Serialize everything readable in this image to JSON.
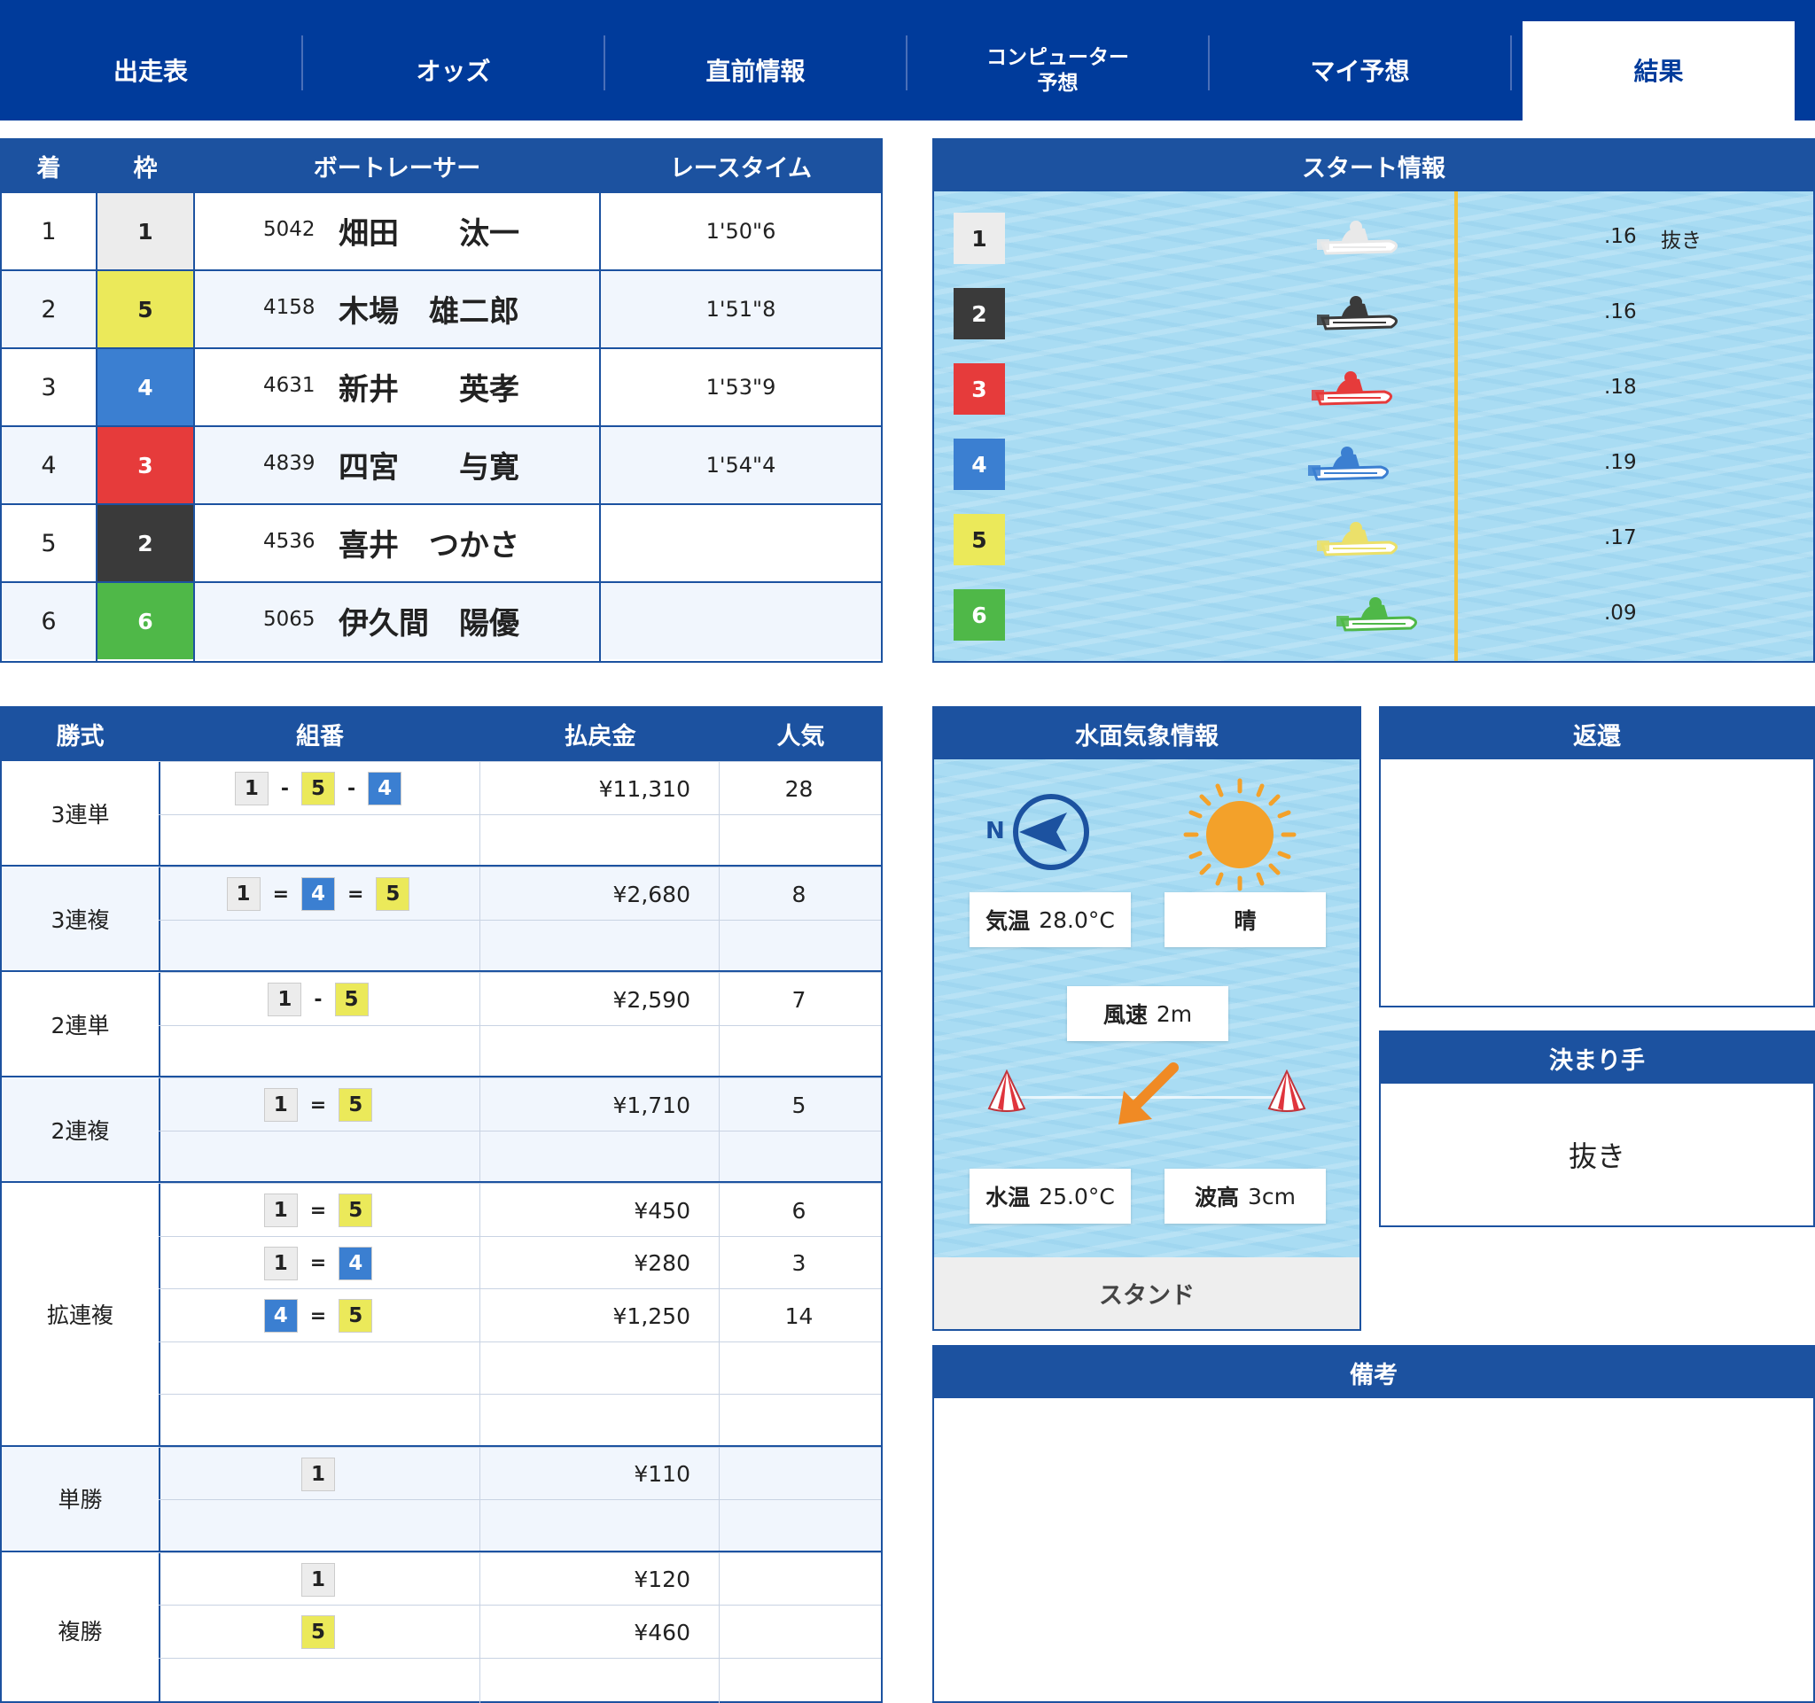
{
  "tabs": [
    {
      "label": "出走表"
    },
    {
      "label": "オッズ"
    },
    {
      "label": "直前情報"
    },
    {
      "label": "コンピューター",
      "label2": "予想"
    },
    {
      "label": "マイ予想"
    },
    {
      "label": "結果"
    }
  ],
  "results": {
    "headers": {
      "rank": "着",
      "lane": "枠",
      "racer": "ボートレーサー",
      "time": "レースタイム"
    },
    "rows": [
      {
        "rank": "1",
        "lane": "1",
        "reg_no": "5042",
        "name": "畑田　　汰一",
        "time": "1'50\"6"
      },
      {
        "rank": "2",
        "lane": "5",
        "reg_no": "4158",
        "name": "木場　雄二郎",
        "time": "1'51\"8"
      },
      {
        "rank": "3",
        "lane": "4",
        "reg_no": "4631",
        "name": "新井　　英孝",
        "time": "1'53\"9"
      },
      {
        "rank": "4",
        "lane": "3",
        "reg_no": "4839",
        "name": "四宮　　与寛",
        "time": "1'54\"4"
      },
      {
        "rank": "5",
        "lane": "2",
        "reg_no": "4536",
        "name": "喜井　つかさ",
        "time": ""
      },
      {
        "rank": "6",
        "lane": "6",
        "reg_no": "5065",
        "name": "伊久間　陽優",
        "time": ""
      }
    ]
  },
  "start_info": {
    "title": "スタート情報",
    "rows": [
      {
        "lane": "1",
        "st": ".16",
        "tech": "抜き"
      },
      {
        "lane": "2",
        "st": ".16",
        "tech": ""
      },
      {
        "lane": "3",
        "st": ".18",
        "tech": ""
      },
      {
        "lane": "4",
        "st": ".19",
        "tech": ""
      },
      {
        "lane": "5",
        "st": ".17",
        "tech": ""
      },
      {
        "lane": "6",
        "st": ".09",
        "tech": ""
      }
    ]
  },
  "payouts": {
    "headers": {
      "type": "勝式",
      "combo": "組番",
      "amount": "払戻金",
      "popularity": "人気"
    },
    "sections": [
      {
        "type": "3連単",
        "lines": [
          {
            "c": [
              "1",
              "5",
              "4"
            ],
            "s": "-",
            "amount": "¥11,310",
            "pop": "28"
          },
          {}
        ]
      },
      {
        "type": "3連複",
        "lines": [
          {
            "c": [
              "1",
              "4",
              "5"
            ],
            "s": "=",
            "amount": "¥2,680",
            "pop": "8"
          },
          {}
        ]
      },
      {
        "type": "2連単",
        "lines": [
          {
            "c": [
              "1",
              "5"
            ],
            "s": "-",
            "amount": "¥2,590",
            "pop": "7"
          },
          {}
        ]
      },
      {
        "type": "2連複",
        "lines": [
          {
            "c": [
              "1",
              "5"
            ],
            "s": "=",
            "amount": "¥1,710",
            "pop": "5"
          },
          {}
        ]
      },
      {
        "type": "拡連複",
        "lines": [
          {
            "c": [
              "1",
              "5"
            ],
            "s": "=",
            "amount": "¥450",
            "pop": "6"
          },
          {
            "c": [
              "1",
              "4"
            ],
            "s": "=",
            "amount": "¥280",
            "pop": "3"
          },
          {
            "c": [
              "4",
              "5"
            ],
            "s": "=",
            "amount": "¥1,250",
            "pop": "14"
          },
          {},
          {}
        ]
      },
      {
        "type": "単勝",
        "lines": [
          {
            "c": [
              "1"
            ],
            "s": "",
            "amount": "¥110",
            "pop": ""
          },
          {}
        ]
      },
      {
        "type": "複勝",
        "lines": [
          {
            "c": [
              "1"
            ],
            "s": "",
            "amount": "¥120",
            "pop": ""
          },
          {
            "c": [
              "5"
            ],
            "s": "",
            "amount": "¥460",
            "pop": ""
          },
          {}
        ]
      }
    ]
  },
  "weather": {
    "title": "水面気象情報",
    "north_label": "N",
    "air_temp_label": "気温",
    "air_temp": "28.0°C",
    "condition": "晴",
    "wind_label": "風速",
    "wind_speed": "2m",
    "water_temp_label": "水温",
    "water_temp": "25.0°C",
    "wave_label": "波高",
    "wave_height": "3cm",
    "stand_label": "スタンド"
  },
  "refund": {
    "title": "返還",
    "content": ""
  },
  "kimarite": {
    "title": "決まり手",
    "value": "抜き"
  },
  "remarks": {
    "title": "備考",
    "content": ""
  },
  "colors": {
    "nav": "#003b9b",
    "header": "#1c52a0",
    "lane1": "#ececec",
    "lane2": "#3a3a3a",
    "lane3": "#e63b3b",
    "lane4": "#3b7fd1",
    "lane5": "#ebe95a",
    "lane6": "#4fb848",
    "start_line": "#f3c43a",
    "sun": "#f3a12a",
    "wind_arrow": "#f08a24"
  }
}
